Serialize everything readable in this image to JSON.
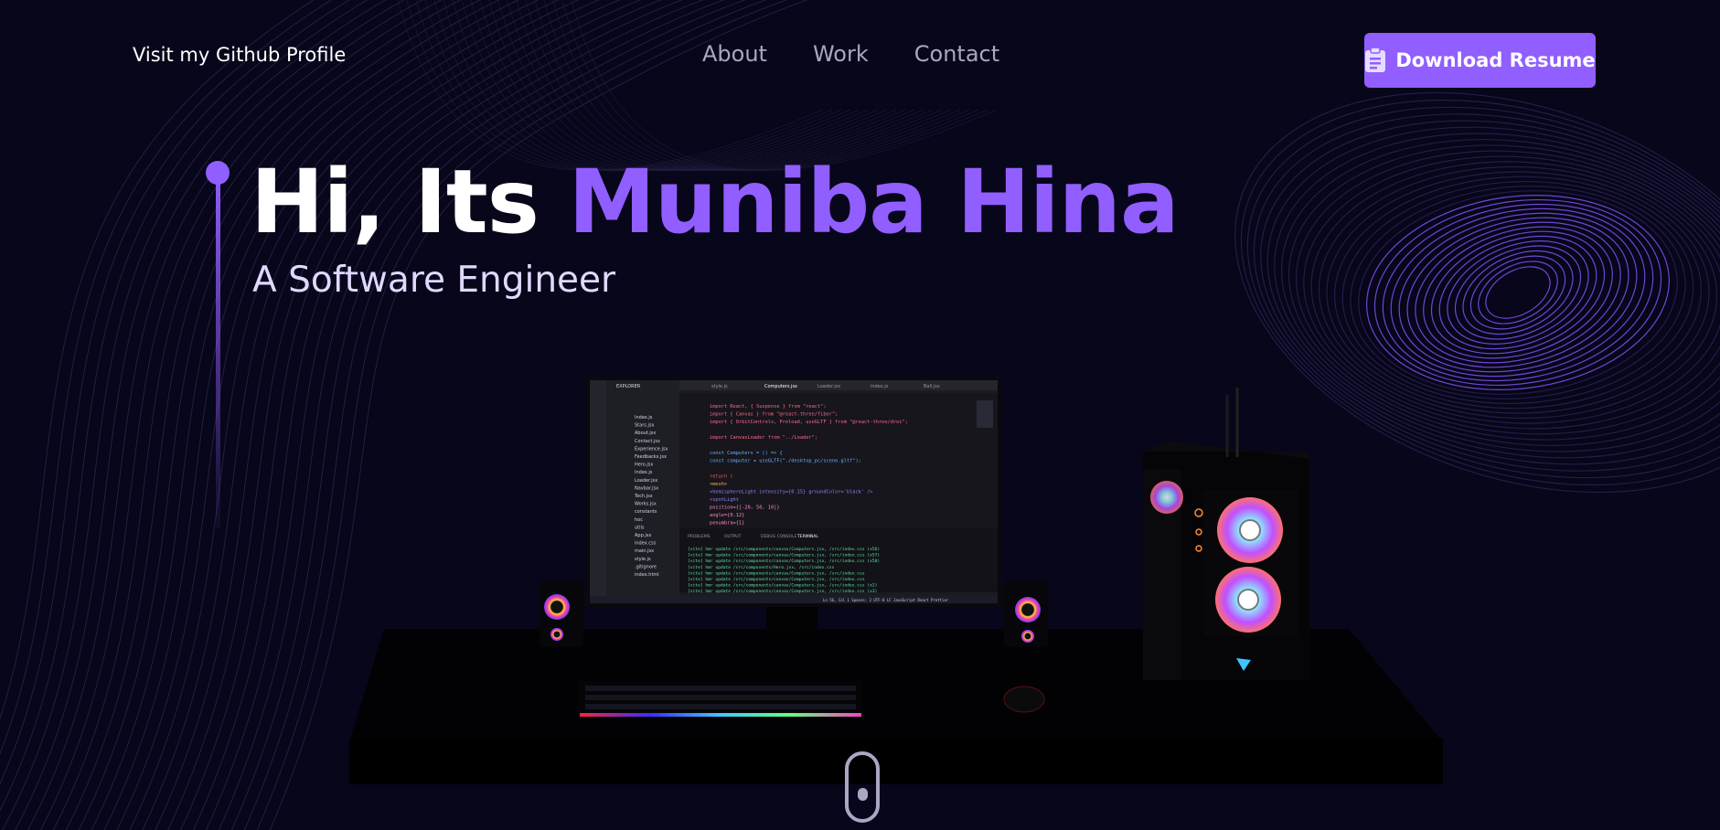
{
  "nav": {
    "github_link": "Visit my Github Profile",
    "links": [
      "About",
      "Work",
      "Contact"
    ],
    "resume_button": "Download Resume"
  },
  "hero": {
    "greeting": "Hi, Its ",
    "name": "Muniba Hina",
    "subtitle": "A Software Engineer"
  },
  "colors": {
    "accent": "#915eff",
    "background": "#07061a",
    "nav_text": "#a9a7bf"
  },
  "editor": {
    "tabs": [
      "style.js",
      "Computers.jsx",
      "Loader.jsx",
      "index.js",
      "Ball.jsx"
    ],
    "explorer_title": "EXPLORER",
    "files": [
      "Index.js",
      "Stars.jsx",
      "About.jsx",
      "Contact.jsx",
      "Experience.jsx",
      "Feedbacks.jsx",
      "Hero.jsx",
      "Index.js",
      "Loader.jsx",
      "Navbar.jsx",
      "Tech.jsx",
      "Works.jsx",
      "constants",
      "hoc",
      "utils",
      "App.jsx",
      "index.css",
      "main.jsx",
      "style.js",
      ".gitignore",
      "index.html"
    ],
    "code_lines": [
      "import React, { Suspense } from \"react\";",
      "import { Canvas } from \"@react-three/fiber\";",
      "import { OrbitControls, Preload, useGLTF } from \"@react-three/drei\";",
      "",
      "import CanvasLoader from \"../Loader\";",
      "",
      "const Computers = () => {",
      "  const computer = useGLTF(\"./desktop_pc/scene.gltf\");",
      "",
      "  return (",
      "    <mesh>",
      "      <hemisphereLight intensity={0.15} groundColor='black' />",
      "      <spotLight",
      "        position={[-20, 50, 10]}",
      "        angle={0.12}",
      "        penumbra={1}"
    ],
    "panel_tabs": [
      "PROBLEMS",
      "OUTPUT",
      "DEBUG CONSOLE",
      "TERMINAL"
    ],
    "terminal_lines": [
      "[vite] hmr update /src/components/canvas/Computers.jsx, /src/index.css (x56)",
      "[vite] hmr update /src/components/canvas/Computers.jsx, /src/index.css (x57)",
      "[vite] hmr update /src/components/canvas/Computers.jsx, /src/index.css (x58)",
      "[vite] hmr update /src/components/Hero.jsx, /src/index.css",
      "[vite] hmr update /src/components/canvas/Computers.jsx, /src/index.css",
      "[vite] hmr update /src/components/canvas/Computers.jsx, /src/index.css",
      "[vite] hmr update /src/components/canvas/Computers.jsx, /src/index.css (x2)",
      "[vite] hmr update /src/components/canvas/Computers.jsx, /src/index.css (x3)"
    ],
    "status_bar": "Ln 56, Col 1   Spaces: 2   UTF-8   LF   JavaScript React   Prettier"
  }
}
